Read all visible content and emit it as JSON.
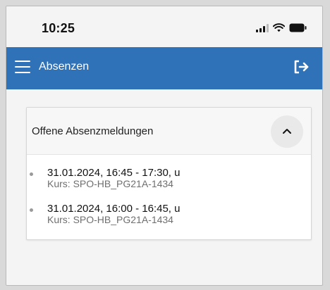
{
  "status_bar": {
    "time": "10:25"
  },
  "app_bar": {
    "title": "Absenzen",
    "menu_icon": "hamburger-menu-icon",
    "logout_icon": "logout-icon"
  },
  "panel": {
    "title": "Offene Absenzmeldungen",
    "collapse_icon": "chevron-up-icon",
    "items": [
      {
        "title": "31.01.2024, 16:45 - 17:30, u",
        "course": "Kurs: SPO-HB_PG21A-1434"
      },
      {
        "title": "31.01.2024, 16:00 - 16:45, u",
        "course": "Kurs: SPO-HB_PG21A-1434"
      }
    ]
  },
  "colors": {
    "primary": "#2f72b8",
    "background": "#f4f4f5",
    "card": "#ffffff"
  }
}
